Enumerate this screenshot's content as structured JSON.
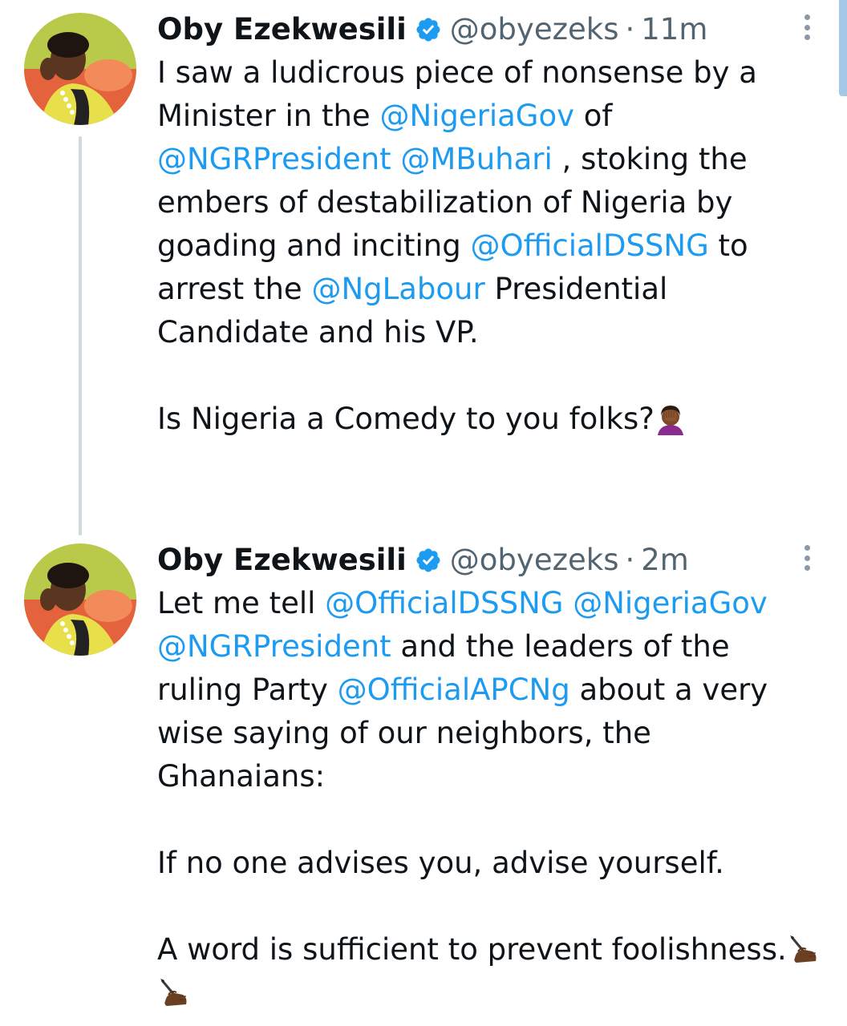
{
  "tweets": [
    {
      "author_name": "Oby Ezekwesili",
      "handle": "@obyezeks",
      "separator": "·",
      "time": "11m",
      "segments": [
        [
          {
            "text": "I saw a ludicrous piece of nonsense by a Minister in the "
          },
          {
            "text": "@NigeriaGov",
            "mention": true
          },
          {
            "text": " of "
          },
          {
            "text": "@NGRPresident",
            "mention": true
          },
          {
            "text": " "
          },
          {
            "text": "@MBuhari",
            "mention": true
          },
          {
            "text": " , stoking the embers of destabilization of Nigeria by goading and inciting "
          },
          {
            "text": "@OfficialDSSNG",
            "mention": true
          },
          {
            "text": " to arrest the "
          },
          {
            "text": "@NgLabour",
            "mention": true
          },
          {
            "text": " Presidential Candidate and his VP."
          }
        ],
        [
          {
            "text": "Is Nigeria a Comedy to you folks?"
          },
          {
            "emoji": "facepalm-emoji"
          }
        ]
      ]
    },
    {
      "author_name": "Oby Ezekwesili",
      "handle": "@obyezeks",
      "separator": "·",
      "time": "2m",
      "segments": [
        [
          {
            "text": "Let me tell "
          },
          {
            "text": "@OfficialDSSNG",
            "mention": true
          },
          {
            "text": " "
          },
          {
            "text": "@NigeriaGov",
            "mention": true
          },
          {
            "text": " "
          },
          {
            "text": "@NGRPresident",
            "mention": true
          },
          {
            "text": " and the leaders of the ruling Party "
          },
          {
            "text": "@OfficialAPCNg",
            "mention": true
          },
          {
            "text": " about a very wise saying of our neighbors, the Ghanaians:"
          }
        ],
        [
          {
            "text": "If no one advises you, advise yourself."
          }
        ],
        [
          {
            "text": "A word is sufficient to prevent foolishness."
          },
          {
            "emoji": "writing-hand-emoji"
          },
          {
            "emoji": "writing-hand-emoji"
          }
        ]
      ]
    }
  ],
  "icons": {
    "verified": "verified-badge-icon",
    "more": "more-options-icon"
  },
  "colors": {
    "mention": "#1d9bf0",
    "verified": "#1d9bf0",
    "secondary_text": "#536471",
    "thread_line": "#cfd9de"
  }
}
